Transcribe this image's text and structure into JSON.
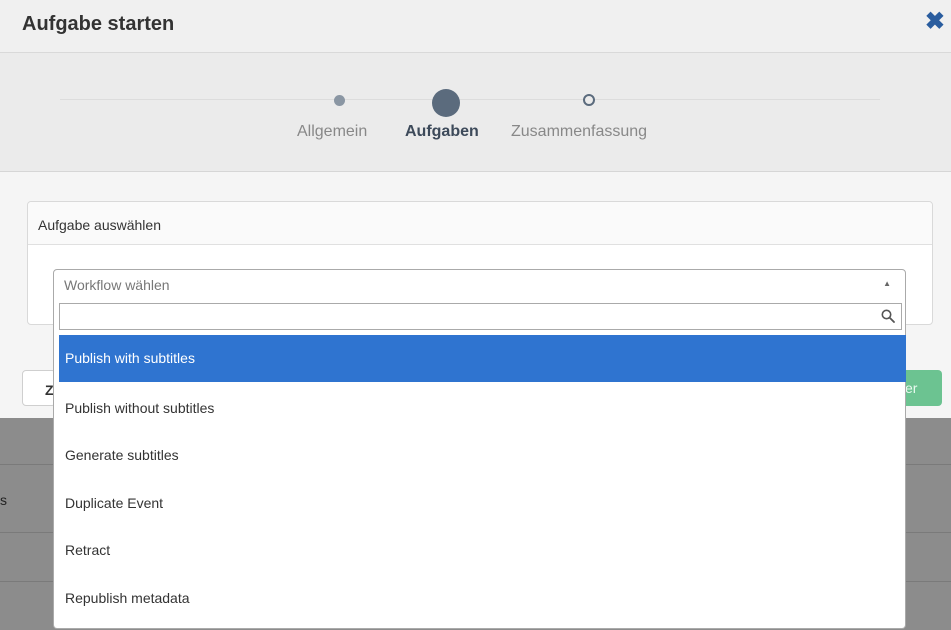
{
  "modal": {
    "title": "Aufgabe starten",
    "close_symbol": "✖",
    "steps": [
      {
        "label": "Allgemein",
        "state": "done"
      },
      {
        "label": "Aufgaben",
        "state": "active"
      },
      {
        "label": "Zusammenfassung",
        "state": "upcoming"
      }
    ],
    "panel_title": "Aufgabe auswählen",
    "footer_left_label": "Z",
    "footer_right_label": "er"
  },
  "select": {
    "placeholder": "Workflow wählen",
    "search_value": "",
    "options": [
      {
        "label": "Publish with subtitles",
        "highlighted": true
      },
      {
        "label": "Publish without subtitles",
        "highlighted": false
      },
      {
        "label": "Generate subtitles",
        "highlighted": false
      },
      {
        "label": "Duplicate Event",
        "highlighted": false
      },
      {
        "label": "Retract",
        "highlighted": false
      },
      {
        "label": "Republish metadata",
        "highlighted": false
      }
    ]
  },
  "background": {
    "partial_text": "s"
  },
  "colors": {
    "accent": "#2f74d0",
    "close": "#2a5d9f",
    "confirm_button": "#6cc391",
    "active_step": "#5b6b7d"
  }
}
